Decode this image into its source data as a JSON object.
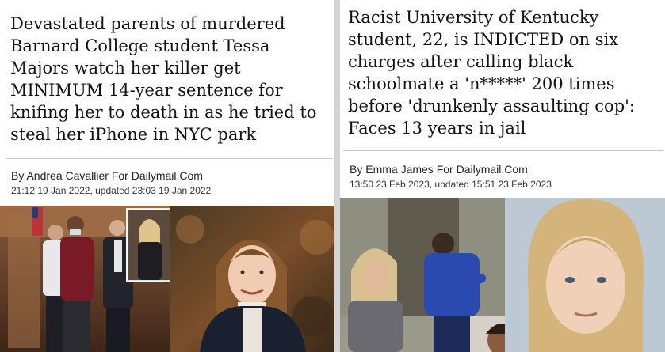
{
  "left_article": {
    "headline": "Devastated parents of murdered Barnard College student Tessa Majors watch her killer get MINIMUM 14-year sentence for knifing her to death in as he tried to steal her iPhone in NYC park",
    "byline": "By Andrea Cavallier For Dailymail.Com",
    "timestamp": "21:12 19 Jan 2022, updated 23:03 19 Jan 2022"
  },
  "right_article": {
    "headline": "Racist University of Kentucky student, 22, is INDICTED on six charges after calling black schoolmate a 'n*****' 200 times before 'drunkenly assaulting cop': Faces 13 years in jail",
    "byline": "By Emma James For Dailymail.Com",
    "timestamp": "13:50 23 Feb 2023, updated 15:51 23 Feb 2023"
  },
  "colors": {
    "panel_background": "#ffffff",
    "page_background": "#d4d4d4",
    "divider": "#c8c8c8",
    "headline_text": "#111111"
  }
}
